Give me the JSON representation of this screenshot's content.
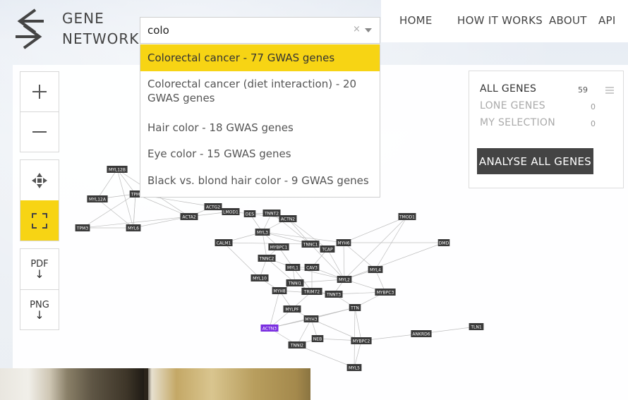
{
  "app": {
    "logo_line1": "GENE",
    "logo_line2": "NETWORK"
  },
  "nav": {
    "items": [
      "HOME",
      "HOW IT WORKS",
      "ABOUT",
      "API"
    ]
  },
  "search": {
    "value": "colo",
    "clear_symbol": "×"
  },
  "dropdown": {
    "items": [
      {
        "line1": "Colorectal cancer - 77 GWAS genes",
        "line2": "",
        "selected": true
      },
      {
        "line1": "Colorectal cancer (diet interaction) - 20",
        "line2": "GWAS genes",
        "selected": false
      },
      {
        "line1": "Hair color - 18 GWAS genes",
        "line2": "",
        "selected": false
      },
      {
        "line1": "Eye color - 15 GWAS genes",
        "line2": "",
        "selected": false
      },
      {
        "line1": "Black vs. blond hair color - 9 GWAS genes",
        "line2": "",
        "selected": false
      }
    ]
  },
  "toolbar": {
    "zoom_in_icon": "plus-icon",
    "zoom_out_icon": "minus-icon",
    "move_icon": "move-arrows-icon",
    "fit_icon": "fit-screen-icon",
    "pdf_label": "PDF",
    "png_label": "PNG",
    "download_arrow": "↓"
  },
  "gene_sets": {
    "all_genes": {
      "label": "ALL GENES",
      "count": "59"
    },
    "lone_genes": {
      "label": "LONE GENES",
      "count": "0"
    },
    "my_selection": {
      "label": "MY SELECTION",
      "count": "0"
    },
    "analyse_button": "ANALYSE ALL GENES"
  },
  "colors": {
    "accent_yellow": "#f7d414",
    "node_dark": "#3a3a3a",
    "node_highlight": "#7a2ee0",
    "edge": "#bdbdbd"
  },
  "network": {
    "highlighted_node": "ACTN3",
    "nodes": [
      {
        "id": "MYL12B"
      },
      {
        "id": "MYL12A"
      },
      {
        "id": "TPM"
      },
      {
        "id": "TPM3"
      },
      {
        "id": "MYL6"
      },
      {
        "id": "ACTA2"
      },
      {
        "id": "ACTG2"
      },
      {
        "id": "LMOD1"
      },
      {
        "id": "DES"
      },
      {
        "id": "TNNT2"
      },
      {
        "id": "ACTN2"
      },
      {
        "id": "MYL3"
      },
      {
        "id": "CALM1"
      },
      {
        "id": "MYBPC1"
      },
      {
        "id": "TNNC1"
      },
      {
        "id": "TCAP"
      },
      {
        "id": "MYH6"
      },
      {
        "id": "TNNC2"
      },
      {
        "id": "MYL1"
      },
      {
        "id": "CAV3"
      },
      {
        "id": "MYL4"
      },
      {
        "id": "MYL10"
      },
      {
        "id": "TNNI1"
      },
      {
        "id": "MYL2"
      },
      {
        "id": "MYH8"
      },
      {
        "id": "TRIM72"
      },
      {
        "id": "TNNT3"
      },
      {
        "id": "MYBPC3"
      },
      {
        "id": "TTN"
      },
      {
        "id": "MYLPF"
      },
      {
        "id": "MYH3"
      },
      {
        "id": "ACTN3"
      },
      {
        "id": "NEB"
      },
      {
        "id": "TNNI2"
      },
      {
        "id": "MYBPC2"
      },
      {
        "id": "ANKRD6"
      },
      {
        "id": "TLN1"
      },
      {
        "id": "MYL5"
      },
      {
        "id": "TMOD1"
      },
      {
        "id": "DMD"
      }
    ]
  }
}
